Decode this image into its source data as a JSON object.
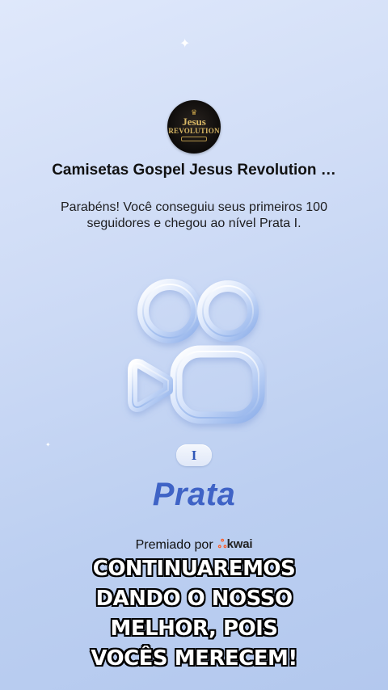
{
  "profile": {
    "avatar_text_line1": "Jesus",
    "avatar_text_line2": "REVOLUTION",
    "name": "Camisetas Gospel Jesus Revolution …"
  },
  "achievement": {
    "message": "Parabéns! Você conseguiu seus primeiros 100 seguidores e chegou ao nível Prata I.",
    "level_numeral": "I",
    "level_name": "Prata",
    "level_color": "#3f63c6"
  },
  "footer": {
    "awarded_by_label": "Premiado por",
    "brand_icon": "kwai-logo-icon",
    "brand_name": "kwai",
    "brand_color": "#ff5a20"
  },
  "caption": {
    "line1": "CONTINUAREMOS",
    "line2": "DANDO O NOSSO",
    "line3": "MELHOR, POIS",
    "line4": "VOCÊS MERECEM!"
  }
}
